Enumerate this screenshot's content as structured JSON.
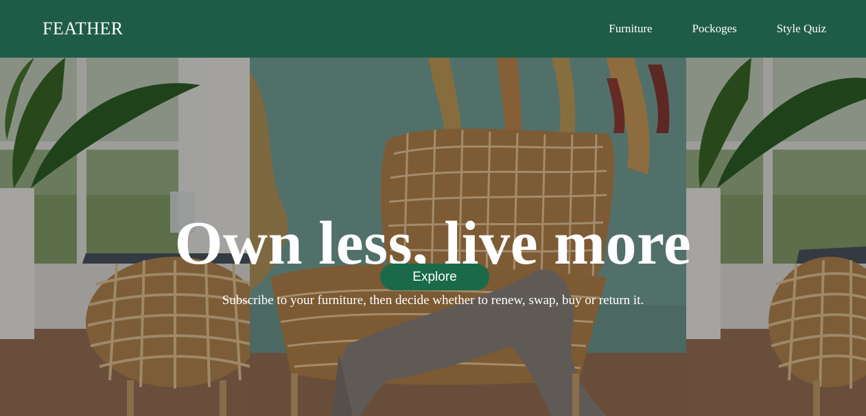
{
  "nav": {
    "brand": "FEATHER",
    "links": [
      "Furniture",
      "Pockoges",
      "Style Quiz"
    ]
  },
  "hero": {
    "title": "Own less, live more",
    "subtitle": "Subscribe to your furniture, then decide whether to renew, swap, buy or return it.",
    "cta_label": "Explore"
  },
  "colors": {
    "nav_bg": "#1f5c48",
    "button_bg": "#1a6a4a",
    "text": "#ffffff"
  }
}
